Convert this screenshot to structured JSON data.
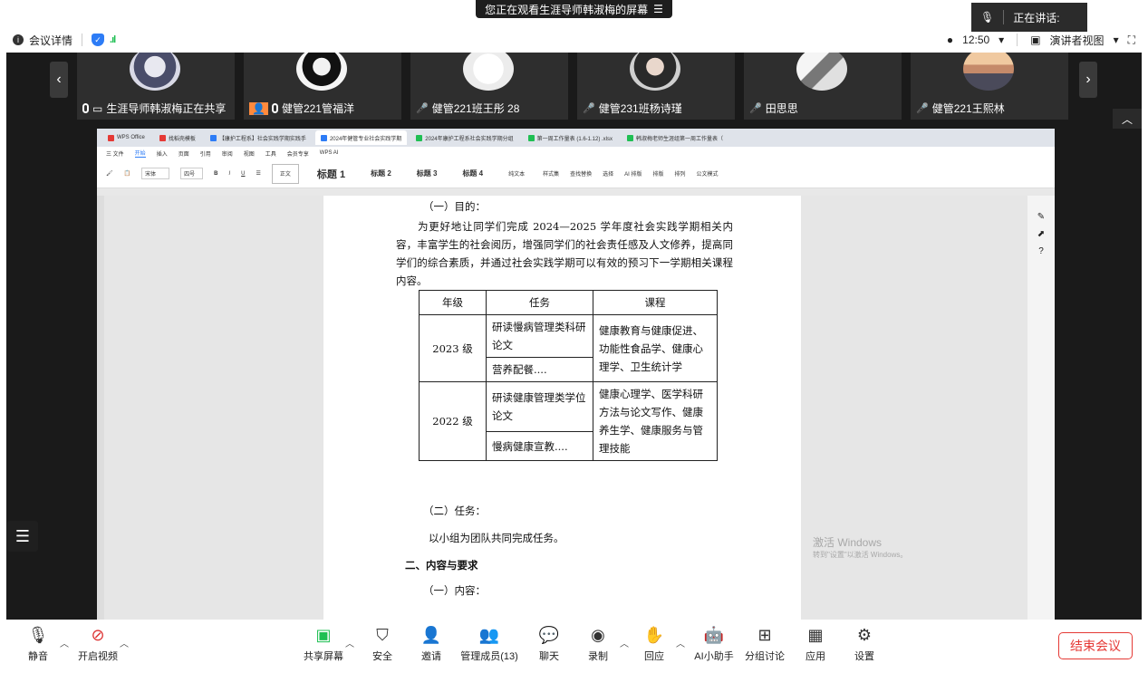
{
  "banner": {
    "sharing_text": "您正在观看生涯导师韩淑梅的屏幕",
    "menu_icon": "list-icon"
  },
  "speaking": {
    "label": "正在讲话:"
  },
  "infobar": {
    "meeting_details": "会议详情",
    "time": "12:50",
    "view_mode": "演讲者视图"
  },
  "participants": [
    {
      "name": "生涯导师韩淑梅正在共享",
      "mic": "on"
    },
    {
      "name": "健管221管福洋",
      "mic": "on"
    },
    {
      "name": "健管221班王彤 28",
      "mic": "off"
    },
    {
      "name": "健管231班杨诗瑾",
      "mic": "off"
    },
    {
      "name": "田思思",
      "mic": "off"
    },
    {
      "name": "健管221王熙林",
      "mic": "off"
    }
  ],
  "wps": {
    "tabs": [
      {
        "label": "WPS Office",
        "color": "#e53935"
      },
      {
        "label": "找稻壳模板",
        "color": "#e53935"
      },
      {
        "label": "【康护工程系】社会实践学期实践手",
        "color": "#2d7cf6"
      },
      {
        "label": "2024年健管专业社会实践学期",
        "color": "#2d7cf6",
        "active": true
      },
      {
        "label": "2024年康护工程系社会实践学期分组",
        "color": "#1fbf53"
      },
      {
        "label": "第一周工作量表 (1.6-1.12) .xlsx",
        "color": "#1fbf53"
      },
      {
        "label": "韩淑梅老师生涯组第一周工作量表（",
        "color": "#1fbf53"
      }
    ],
    "menus": [
      "三 文件",
      "开始",
      "插入",
      "页面",
      "引用",
      "审阅",
      "视图",
      "工具",
      "会员专享",
      "WPS AI"
    ],
    "active_menu": "开始",
    "styles": [
      "正文",
      "标题 1",
      "标题 2",
      "标题 3",
      "标题 4",
      "纯文本"
    ],
    "ribbon_right": [
      "样式集",
      "查找替换",
      "选择",
      "AI 排版",
      "排版",
      "排列",
      "公文模式"
    ]
  },
  "document": {
    "heading1": "（一）目的：",
    "paragraph": "为更好地让同学们完成 2024—2025 学年度社会实践学期相关内容，丰富学生的社会阅历，增强同学们的社会责任感及人文修养，提高同学们的综合素质，并通过社会实践学期可以有效的预习下一学期相关课程内容。",
    "table": {
      "headers": [
        "年级",
        "任务",
        "课程"
      ],
      "rows": [
        {
          "grade": "2023 级",
          "tasks": [
            "研读慢病管理类科研论文",
            "营养配餐...."
          ],
          "course": "健康教育与健康促进、功能性食品学、健康心理学、卫生统计学"
        },
        {
          "grade": "2022 级",
          "tasks": [
            "研读健康管理类学位论文",
            "慢病健康宣教...."
          ],
          "course": "健康心理学、医学科研方法与论文写作、健康养生学、健康服务与管理技能"
        }
      ]
    },
    "heading2": "（二）任务：",
    "task_text": "以小组为团队共同完成任务。",
    "section2": "二、内容与要求",
    "heading3": "（一）内容："
  },
  "watermark": {
    "line1": "激活 Windows",
    "line2": "转到\"设置\"以激活 Windows。"
  },
  "toolbar": {
    "mute": "静音",
    "video": "开启视频",
    "share": "共享屏幕",
    "security": "安全",
    "invite": "邀请",
    "members": "管理成员(13)",
    "chat": "聊天",
    "record": "录制",
    "react": "回应",
    "ai": "AI小助手",
    "breakout": "分组讨论",
    "apps": "应用",
    "settings": "设置",
    "end": "结束会议"
  }
}
